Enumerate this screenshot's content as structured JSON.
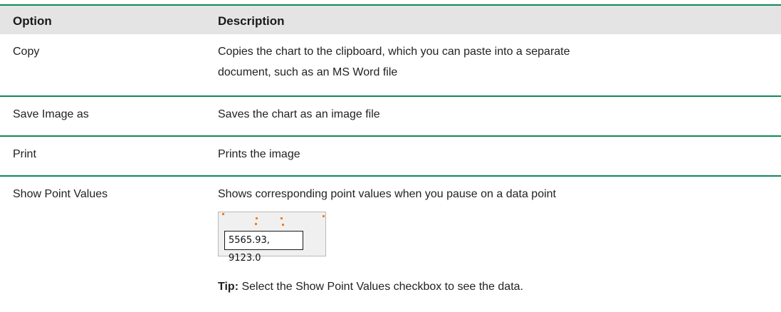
{
  "table": {
    "columns": {
      "option": "Option",
      "description": "Description"
    },
    "rows": [
      {
        "option": "Copy",
        "description_line1": "Copies the chart to the clipboard, which you can paste into a separate",
        "description_line2": "document, such as an MS Word file"
      },
      {
        "option": "Save Image as",
        "description_line1": "Saves the chart as an image file"
      },
      {
        "option": "Print",
        "description_line1": "Prints the image"
      },
      {
        "option": "Show Point Values",
        "description_line1": "Shows corresponding point values when you pause on a data point",
        "example_tooltip": "5565.93, 9123.0",
        "tip_label": "Tip:",
        "tip_text": " Select the Show Point Values checkbox to see the data."
      }
    ]
  },
  "colors": {
    "rule": "#0e8a53",
    "header_bg": "#e4e4e4",
    "point": "#ef7e22"
  }
}
